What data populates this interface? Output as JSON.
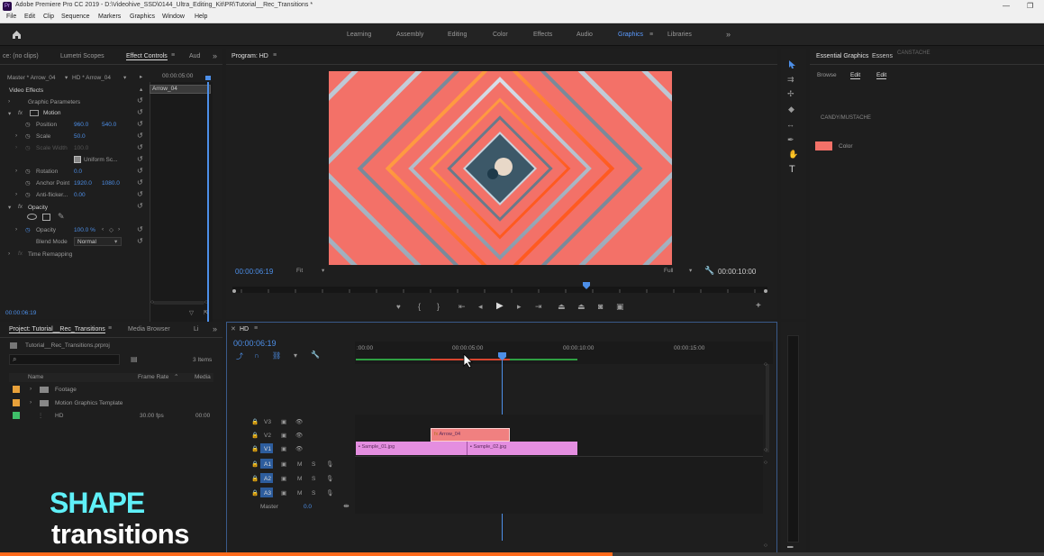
{
  "titlebar": {
    "title": "Adobe Premiere Pro CC 2019 - D:\\Videohive_SSD\\0144_Ultra_Editing_Kit\\PR\\Tutorial__Rec_Transitions *",
    "minimize": "—",
    "restore": "❐"
  },
  "menu": [
    "File",
    "Edit",
    "Clip",
    "Sequence",
    "Markers",
    "Graphics",
    "Window",
    "Help"
  ],
  "workspaces": {
    "items": [
      "Learning",
      "Assembly",
      "Editing",
      "Color",
      "Effects",
      "Audio",
      "Graphics",
      "Libraries"
    ],
    "active": "Graphics",
    "more": "»",
    "menu_icon": "≡"
  },
  "effect_controls": {
    "tabs": [
      "ce: (no clips)",
      "Lumetri Scopes",
      "Effect Controls",
      "Aud"
    ],
    "more": "»",
    "master_label": "Master * Arrow_04",
    "sequence_label": "HD * Arrow_04",
    "timecode_top": "00:00:05:00",
    "clip_label": "Arrow_04",
    "video_effects": "Video Effects",
    "graphic_parameters": "Graphic Parameters",
    "motion": "Motion",
    "position": {
      "label": "Position",
      "x": "960.0",
      "y": "540.0"
    },
    "scale": {
      "label": "Scale",
      "value": "50.0"
    },
    "scale_width": {
      "label": "Scale Width",
      "value": "100.0"
    },
    "uniform_scale": "Uniform Sc...",
    "rotation": {
      "label": "Rotation",
      "value": "0.0"
    },
    "anchor_point": {
      "label": "Anchor Point",
      "x": "1920.0",
      "y": "1080.0"
    },
    "anti_flicker": {
      "label": "Anti-flicker...",
      "value": "0.00"
    },
    "opacity_section": "Opacity",
    "opacity": {
      "label": "Opacity",
      "value": "100.0 %"
    },
    "blend_mode": {
      "label": "Blend Mode",
      "value": "Normal"
    },
    "time_remapping": "Time Remapping",
    "timecode_bottom": "00:00:06:19",
    "fx": "fx"
  },
  "program": {
    "title": "Program: HD",
    "timecode": "00:00:06:19",
    "fit": "Fit",
    "quality": "Full",
    "duration": "00:00:10:00",
    "menu_icon": "≡"
  },
  "project": {
    "tabs": [
      "Project: Tutorial__Rec_Transitions",
      "Media Browser",
      "Li"
    ],
    "file": "Tutorial__Rec_Transitions.prproj",
    "item_count": "3 Items",
    "columns": [
      "Name",
      "Frame Rate",
      "Media"
    ],
    "rows": [
      {
        "name": "Footage",
        "rate": "",
        "media": "",
        "color": "#e8a13a"
      },
      {
        "name": "Motion Graphics Template",
        "rate": "",
        "media": "",
        "color": "#e8a13a"
      },
      {
        "name": "HD",
        "rate": "30.00 fps",
        "media": "00:00",
        "color": "#3fbf6a"
      }
    ]
  },
  "timeline": {
    "title": "HD",
    "timecode": "00:00:06:19",
    "ruler": [
      ":00:00",
      "00:00:05:00",
      "00:00:10:00",
      "00:00:15:00"
    ],
    "tracks": [
      "V3",
      "V2",
      "V1",
      "A1",
      "A2",
      "A3"
    ],
    "master": "Master",
    "master_value": "0.0",
    "clips": {
      "arrow": "Arrow_04",
      "sample1": "Sample_01.jpg",
      "sample2": "Sample_02.jpg"
    }
  },
  "essential_graphics": {
    "tabs": [
      "Essential Graphics",
      "Essens",
      "CANSTACHE"
    ],
    "subtabs": [
      "Browse",
      "Edit",
      "Edit"
    ],
    "layer": "CANDY/MUSTACHE",
    "color_label": "Color",
    "swatch": "#f37168"
  },
  "branding": {
    "line1": "SHAPE",
    "line2": "transitions"
  },
  "colors": {
    "accent": "#4d8fe8",
    "clip_pink": "#e48ee0",
    "clip_red": "#f08080",
    "video_bg": "#f37168"
  }
}
